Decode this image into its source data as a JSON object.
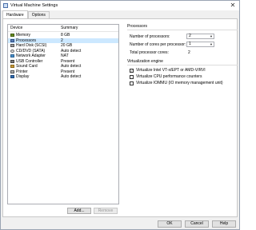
{
  "window": {
    "title": "Virtual Machine Settings",
    "close_glyph": "✕"
  },
  "tabs": [
    {
      "label": "Hardware",
      "active": true
    },
    {
      "label": "Options",
      "active": false
    }
  ],
  "device_list": {
    "col_device": "Device",
    "col_summary": "Summary",
    "rows": [
      {
        "device": "Memory",
        "summary": "8 GB",
        "icon": "memory-icon"
      },
      {
        "device": "Processors",
        "summary": "2",
        "icon": "processor-icon",
        "selected": true
      },
      {
        "device": "Hard Disk (SCSI)",
        "summary": "20 GB",
        "icon": "hard-disk-icon"
      },
      {
        "device": "CD/DVD (SATA)",
        "summary": "Auto detect",
        "icon": "cd-dvd-icon"
      },
      {
        "device": "Network Adapter",
        "summary": "NAT",
        "icon": "network-adapter-icon"
      },
      {
        "device": "USB Controller",
        "summary": "Present",
        "icon": "usb-controller-icon"
      },
      {
        "device": "Sound Card",
        "summary": "Auto detect",
        "icon": "sound-card-icon"
      },
      {
        "device": "Printer",
        "summary": "Present",
        "icon": "printer-icon"
      },
      {
        "device": "Display",
        "summary": "Auto detect",
        "icon": "display-icon"
      }
    ],
    "add_label": "Add...",
    "remove_label": "Remove"
  },
  "processors": {
    "title": "Processors",
    "num_processors_label": "Number of processors:",
    "num_processors_value": "2",
    "cores_label": "Number of cores per processor:",
    "cores_value": "1",
    "total_label": "Total processor cores:",
    "total_value": "2"
  },
  "virtualization": {
    "title": "Virtualization engine",
    "options": [
      {
        "label": "Virtualize Intel VT-x/EPT or AMD-V/RVI",
        "checked": true
      },
      {
        "label": "Virtualize CPU performance counters",
        "checked": false
      },
      {
        "label": "Virtualize IOMMU (IO memory management unit)",
        "checked": false
      }
    ]
  },
  "footer": {
    "ok_label": "OK",
    "cancel_label": "Cancel",
    "help_label": "Help"
  }
}
